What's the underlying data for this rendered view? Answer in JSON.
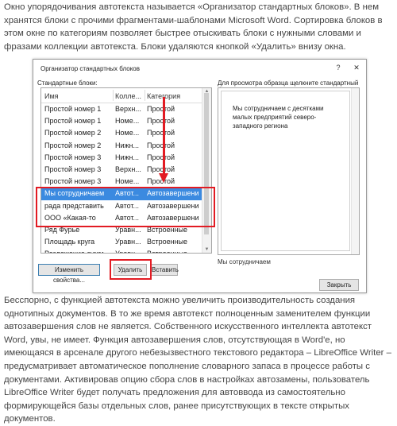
{
  "article": {
    "intro": "Окно упорядочивания автотекста называется «Организатор стандартных блоков». В нем хранятся блоки с прочими фрагментами-шаблонами Microsoft Word. Сортировка блоков в этом окне по категориям позволяет быстрее отыскивать блоки с нужными словами и фразами коллекции автотекста. Блоки удаляются кнопкой «Удалить» внизу окна.",
    "outro": "Бесспорно, с функцией автотекста можно увеличить производительность создания однотипных документов. В то же время автотекст полноценным заменителем функции автозавершения слов не является. Собственного искусственного интеллекта автотекст Word, увы, не имеет. Функция автозавершения слов, отсутствующая в Word'е, но имеющаяся в арсенале другого небезызвестного текстового редактора – LibreOffice Writer – предусматривает автоматическое пополнение словарного запаса в процессе работы с документами. Активировав опцию сбора слов в настройках автозамены, пользователь LibreOffice Writer будет получать предложения для автоввода из самостоятельно формирующейся базы отдельных слов, ранее присутствующих в тексте открытых документов."
  },
  "dialog": {
    "title": "Организатор стандартных блоков",
    "help_label": "?",
    "close_label": "✕",
    "blocks_label": "Стандартные блоки:",
    "preview_label": "Для просмотра образца щелкните стандартный блок",
    "columns": [
      "Имя",
      "Колле...",
      "Категория"
    ],
    "rows": [
      {
        "name": "Простой номер 1",
        "collection": "Верхн...",
        "category": "Простой"
      },
      {
        "name": "Простой номер 1",
        "collection": "Номе...",
        "category": "Простой"
      },
      {
        "name": "Простой номер 2",
        "collection": "Номе...",
        "category": "Простой"
      },
      {
        "name": "Простой номер 2",
        "collection": "Нижн...",
        "category": "Простой"
      },
      {
        "name": "Простой номер 3",
        "collection": "Нижн...",
        "category": "Простой"
      },
      {
        "name": "Простой номер 3",
        "collection": "Верхн...",
        "category": "Простой"
      },
      {
        "name": "Простой номер 3",
        "collection": "Номе...",
        "category": "Простой"
      },
      {
        "name": "Мы сотрудничаем",
        "collection": "Автот...",
        "category": "Автозавершени"
      },
      {
        "name": "рада представить",
        "collection": "Автот...",
        "category": "Автозавершени"
      },
      {
        "name": "ООО «Какая-то",
        "collection": "Автот...",
        "category": "Автозавершени"
      },
      {
        "name": "Ряд Фурье",
        "collection": "Уравн...",
        "category": "Встроенные"
      },
      {
        "name": "Площадь круга",
        "collection": "Уравн...",
        "category": "Встроенные"
      },
      {
        "name": "Разложение сумм",
        "collection": "Уравн...",
        "category": "Встроенные"
      }
    ],
    "selected_row": 7,
    "preview_text": "Мы сотрудничаем с десятками малых предприятий северо-западного региона",
    "preview_caption": "Мы сотрудничаем",
    "buttons": {
      "properties": "Изменить свойства...",
      "delete": "Удалить",
      "insert": "Вставить",
      "close": "Закрыть"
    }
  },
  "colors": {
    "highlight": "#e21b23",
    "selection": "#3b8ae0"
  }
}
